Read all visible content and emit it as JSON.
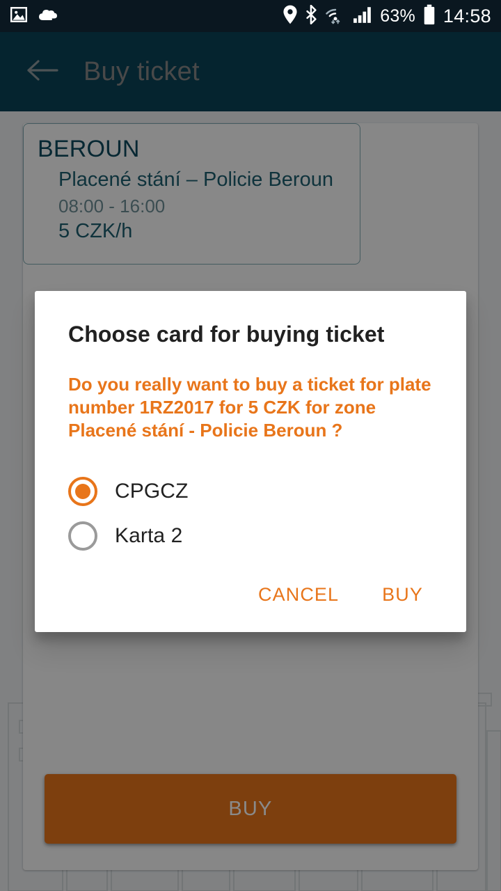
{
  "status_bar": {
    "icons_left": [
      "image-icon",
      "cloud-icon"
    ],
    "icons_right": [
      "location-pin-icon",
      "bluetooth-icon",
      "wifi-icon",
      "signal-icon",
      "battery-icon"
    ],
    "battery_percent": "63%",
    "clock": "14:58"
  },
  "app_bar": {
    "back_icon": "arrow-back-icon",
    "title": "Buy ticket",
    "background_color": "#0b4458",
    "title_color": "#888888"
  },
  "zone_card": {
    "city": "BEROUN",
    "zone_name": "Placené stání – Policie Beroun",
    "hours": "08:00 - 16:00",
    "price": "5 CZK/h",
    "border_color": "#7fa8b0",
    "text_color": "#1d5e70"
  },
  "main_action": {
    "buy_label": "BUY",
    "color": "#e8751a"
  },
  "dialog": {
    "title": "Choose card for buying ticket",
    "message": "Do you really want to buy a ticket for plate number 1RZ2017 for 5 CZK for zone Placené stání - Policie Beroun ?",
    "message_color": "#e8751a",
    "cards": [
      {
        "label": "CPGCZ",
        "selected": true
      },
      {
        "label": "Karta 2",
        "selected": false
      }
    ],
    "cancel_label": "CANCEL",
    "buy_label": "BUY"
  }
}
